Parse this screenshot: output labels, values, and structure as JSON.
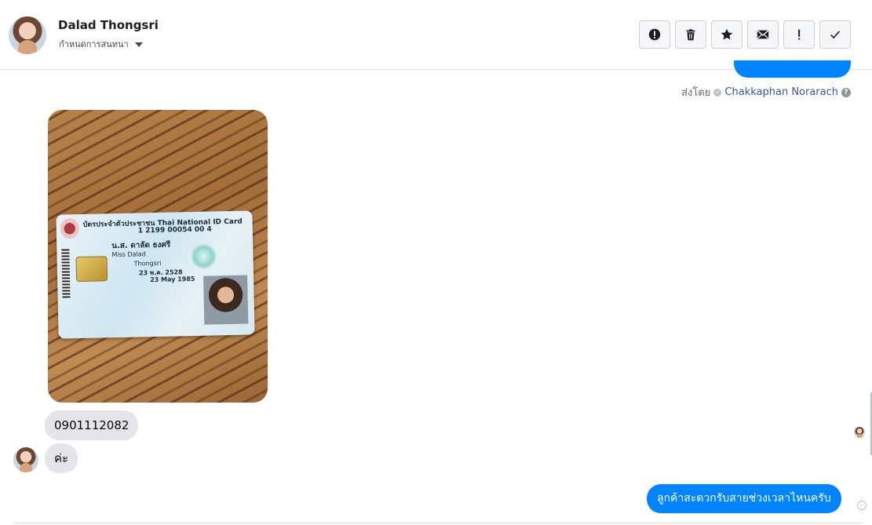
{
  "header": {
    "contact_name": "Dalad Thongsri",
    "subtitle": "กำหนดการสนทนา",
    "toolbar": [
      {
        "icon": "alert-circle-icon"
      },
      {
        "icon": "trash-icon"
      },
      {
        "icon": "star-icon"
      },
      {
        "icon": "envelope-icon"
      },
      {
        "icon": "exclamation-icon"
      },
      {
        "icon": "check-icon"
      }
    ]
  },
  "sent_by": {
    "prefix": "ส่งโดย",
    "agent_name": "Chakkaphan Norarach"
  },
  "id_card": {
    "title_th": "บัตรประจำตัวประชาชน",
    "title_en": "Thai National ID Card",
    "id_number": "1 2199 00054 00 4",
    "name_th": "น.ส. ดาลัด ธงศรี",
    "name_en": "Miss Dalad",
    "last_name_en": "Thongsri",
    "dob_th": "23 พ.ค. 2528",
    "dob_en": "23 May 1985"
  },
  "messages": {
    "phone": "0901112082",
    "reply": "ค่ะ",
    "outgoing": "ลูกค้าสะดวกรับสายช่วงเวลาไหนครับ"
  }
}
